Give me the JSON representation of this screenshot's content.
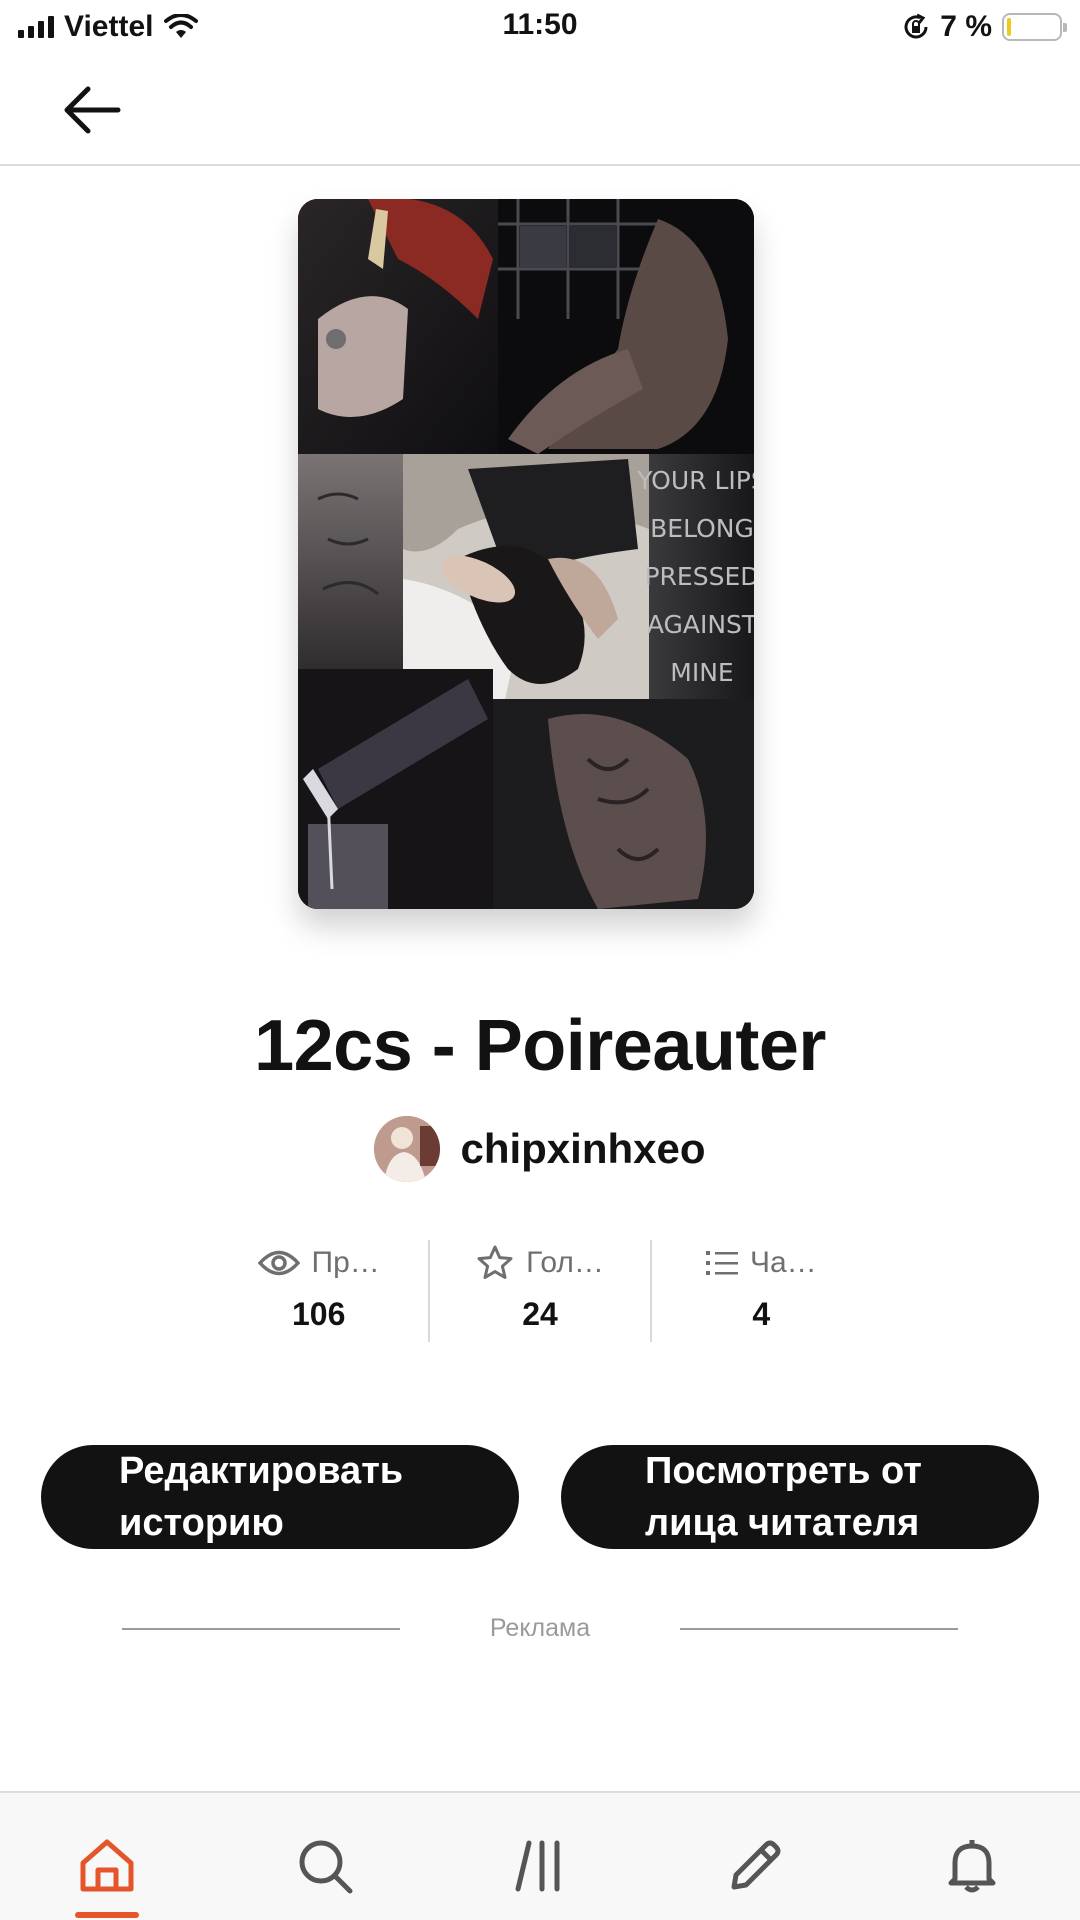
{
  "status_bar": {
    "carrier": "Viettel",
    "time": "11:50",
    "battery_text": "7 %",
    "battery_level": 0.07,
    "battery_color": "#e9cc1f"
  },
  "header": {
    "back_icon": "arrow-left-icon"
  },
  "story": {
    "title": "12cs - Poireauter",
    "author": "chipxinhxeo",
    "cover_text": [
      "YOUR LIPS",
      "BELONG",
      "PRESSED",
      "AGAINST",
      "MINE"
    ]
  },
  "stats": [
    {
      "icon": "eye-icon",
      "label": "Пр…",
      "value": "106"
    },
    {
      "icon": "star-icon",
      "label": "Гол…",
      "value": "24"
    },
    {
      "icon": "list-icon",
      "label": "Ча…",
      "value": "4"
    }
  ],
  "buttons": {
    "edit_label": "Редактировать историю",
    "reader_label": "Посмотреть от лица читателя"
  },
  "ad": {
    "label": "Реклама"
  },
  "bottom_nav": {
    "active": "home",
    "accent": "#e5552c",
    "items": [
      "home-icon",
      "search-icon",
      "library-icon",
      "write-icon",
      "notifications-icon"
    ]
  }
}
